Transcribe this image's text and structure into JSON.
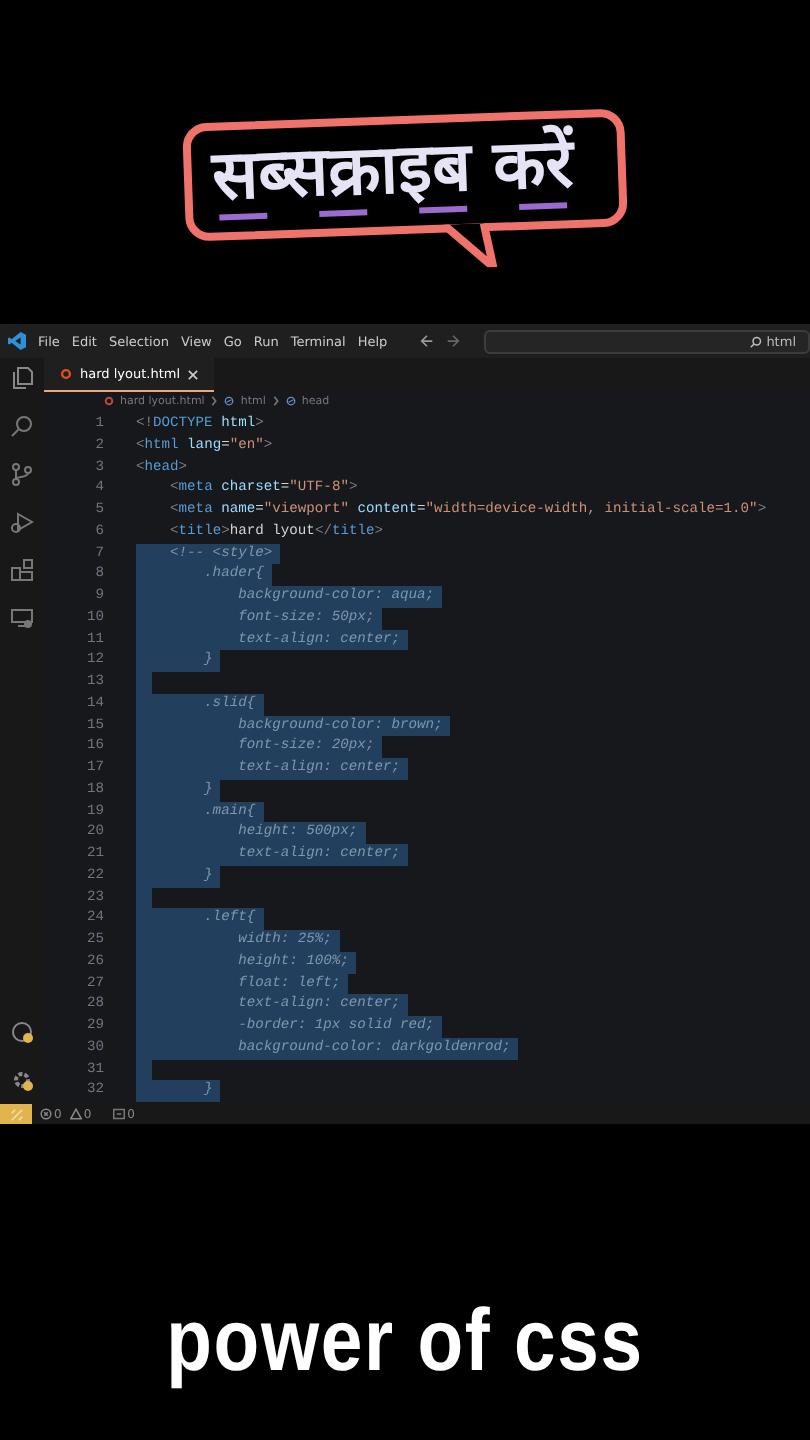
{
  "banner": {
    "text": "सब्सक्राइब करें"
  },
  "editor": {
    "menu": [
      "File",
      "Edit",
      "Selection",
      "View",
      "Go",
      "Run",
      "Terminal",
      "Help"
    ],
    "command_center": {
      "value": "html"
    },
    "tabs": [
      {
        "label": "hard lyout.html",
        "selected": true
      }
    ],
    "breadcrumbs": [
      "hard lyout.html",
      "html",
      "head"
    ],
    "lines": [
      {
        "number": "1",
        "selected": false,
        "tokens": [
          {
            "kind": "punct",
            "text": "<!"
          },
          {
            "kind": "tag",
            "text": "DOCTYPE"
          },
          {
            "kind": "attr",
            "text": " html"
          },
          {
            "kind": "punct",
            "text": ">"
          }
        ]
      },
      {
        "number": "2",
        "selected": false,
        "tokens": [
          {
            "kind": "punct",
            "text": "<"
          },
          {
            "kind": "tag",
            "text": "html"
          },
          {
            "kind": "attr",
            "text": " lang"
          },
          {
            "kind": "plain",
            "text": "="
          },
          {
            "kind": "string",
            "text": "\"en\""
          },
          {
            "kind": "punct",
            "text": ">"
          }
        ]
      },
      {
        "number": "3",
        "selected": false,
        "tokens": [
          {
            "kind": "punct",
            "text": "<"
          },
          {
            "kind": "tag",
            "text": "head"
          },
          {
            "kind": "punct",
            "text": ">"
          }
        ]
      },
      {
        "number": "4",
        "selected": false,
        "tokens": [
          {
            "kind": "punct",
            "text": "    <"
          },
          {
            "kind": "tag",
            "text": "meta"
          },
          {
            "kind": "attr",
            "text": " charset"
          },
          {
            "kind": "plain",
            "text": "="
          },
          {
            "kind": "string",
            "text": "\"UTF-8\""
          },
          {
            "kind": "punct",
            "text": ">"
          }
        ]
      },
      {
        "number": "5",
        "selected": false,
        "tokens": [
          {
            "kind": "punct",
            "text": "    <"
          },
          {
            "kind": "tag",
            "text": "meta"
          },
          {
            "kind": "attr",
            "text": " name"
          },
          {
            "kind": "plain",
            "text": "="
          },
          {
            "kind": "string",
            "text": "\"viewport\""
          },
          {
            "kind": "attr",
            "text": " content"
          },
          {
            "kind": "plain",
            "text": "="
          },
          {
            "kind": "string",
            "text": "\"width=device-width, initial-scale=1.0\""
          },
          {
            "kind": "punct",
            "text": ">"
          }
        ]
      },
      {
        "number": "6",
        "selected": false,
        "tokens": [
          {
            "kind": "punct",
            "text": "    <"
          },
          {
            "kind": "tag",
            "text": "title"
          },
          {
            "kind": "punct",
            "text": ">"
          },
          {
            "kind": "plain",
            "text": "hard lyout"
          },
          {
            "kind": "punct",
            "text": "</"
          },
          {
            "kind": "tag",
            "text": "title"
          },
          {
            "kind": "punct",
            "text": ">"
          }
        ]
      },
      {
        "number": "7",
        "selected": true,
        "tokens": [
          {
            "kind": "comment",
            "text": "    <!-- <style>"
          }
        ]
      },
      {
        "number": "8",
        "selected": true,
        "tokens": [
          {
            "kind": "comment",
            "text": "        .hader{"
          }
        ]
      },
      {
        "number": "9",
        "selected": true,
        "tokens": [
          {
            "kind": "comment",
            "text": "            background-color: aqua;"
          }
        ]
      },
      {
        "number": "10",
        "selected": true,
        "tokens": [
          {
            "kind": "comment",
            "text": "            font-size: 50px;"
          }
        ]
      },
      {
        "number": "11",
        "selected": true,
        "tokens": [
          {
            "kind": "comment",
            "text": "            text-align: center;"
          }
        ]
      },
      {
        "number": "12",
        "selected": true,
        "tokens": [
          {
            "kind": "comment",
            "text": "        }"
          }
        ]
      },
      {
        "number": "13",
        "selected": true
      },
      {
        "number": "14",
        "selected": true,
        "tokens": [
          {
            "kind": "comment",
            "text": "        .slid{"
          }
        ]
      },
      {
        "number": "15",
        "selected": true,
        "tokens": [
          {
            "kind": "comment",
            "text": "            background-color: brown;"
          }
        ]
      },
      {
        "number": "16",
        "selected": true,
        "tokens": [
          {
            "kind": "comment",
            "text": "            font-size: 20px;"
          }
        ]
      },
      {
        "number": "17",
        "selected": true,
        "tokens": [
          {
            "kind": "comment",
            "text": "            text-align: center;"
          }
        ]
      },
      {
        "number": "18",
        "selected": true,
        "tokens": [
          {
            "kind": "comment",
            "text": "        }"
          }
        ]
      },
      {
        "number": "19",
        "selected": true,
        "tokens": [
          {
            "kind": "comment",
            "text": "        .main{"
          }
        ]
      },
      {
        "number": "20",
        "selected": true,
        "tokens": [
          {
            "kind": "comment",
            "text": "            height: 500px;"
          }
        ]
      },
      {
        "number": "21",
        "selected": true,
        "tokens": [
          {
            "kind": "comment",
            "text": "            text-align: center;"
          }
        ]
      },
      {
        "number": "22",
        "selected": true,
        "tokens": [
          {
            "kind": "comment",
            "text": "        }"
          }
        ]
      },
      {
        "number": "23",
        "selected": true
      },
      {
        "number": "24",
        "selected": true,
        "tokens": [
          {
            "kind": "comment",
            "text": "        .left{"
          }
        ]
      },
      {
        "number": "25",
        "selected": true,
        "tokens": [
          {
            "kind": "comment",
            "text": "            width: 25%;"
          }
        ]
      },
      {
        "number": "26",
        "selected": true,
        "tokens": [
          {
            "kind": "comment",
            "text": "            height: 100%;"
          }
        ]
      },
      {
        "number": "27",
        "selected": true,
        "tokens": [
          {
            "kind": "comment",
            "text": "            float: left;"
          }
        ]
      },
      {
        "number": "28",
        "selected": true,
        "tokens": [
          {
            "kind": "comment",
            "text": "            text-align: center;"
          }
        ]
      },
      {
        "number": "29",
        "selected": true,
        "tokens": [
          {
            "kind": "comment",
            "text": "            -border: 1px solid red;"
          }
        ]
      },
      {
        "number": "30",
        "selected": true,
        "tokens": [
          {
            "kind": "comment",
            "text": "            background-color: darkgoldenrod;"
          }
        ]
      },
      {
        "number": "31",
        "selected": true
      },
      {
        "number": "32",
        "selected": true,
        "tokens": [
          {
            "kind": "comment",
            "text": "        }"
          }
        ]
      }
    ],
    "status_bar": {
      "errors": "0",
      "warnings": "0",
      "ports": "0"
    }
  },
  "caption": {
    "text": "power of css"
  }
}
